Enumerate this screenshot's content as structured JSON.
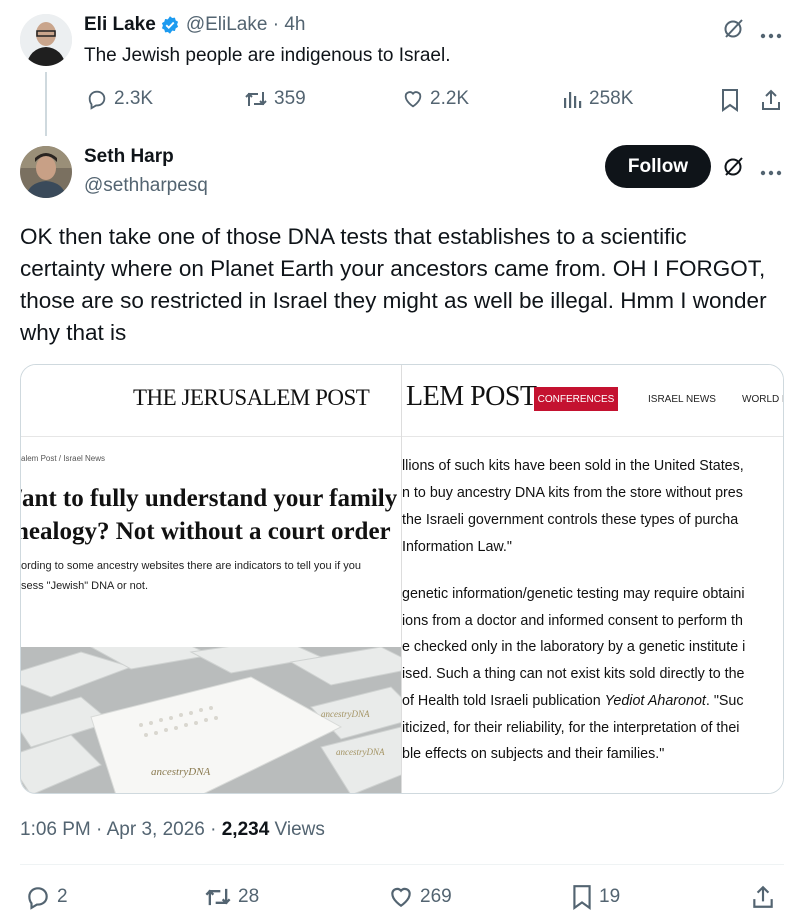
{
  "quoted_tweet": {
    "author_name": "Eli Lake",
    "handle_time": "@EliLake · 4h",
    "text": "The Jewish people are indigenous to Israel.",
    "replies": "2.3K",
    "reposts": "359",
    "likes": "2.2K",
    "views": "258K"
  },
  "main_tweet": {
    "author_name": "Seth Harp",
    "handle": "@sethharpesq",
    "follow_label": "Follow",
    "text": "OK then take one of those DNA tests that establishes to a scientific certainty where on Planet Earth your ancestors came from. OH I FORGOT, those are so restricted in Israel they might as well be illegal. Hmm I wonder why that is",
    "timestamp": "1:06 PM · Apr 3, 2026 · ",
    "view_count": "2,234",
    "views_label": " Views",
    "replies": "2",
    "reposts": "28",
    "likes": "269",
    "bookmarks": "19"
  },
  "article_left": {
    "masthead": "THE JERUSALEM POST",
    "breadcrumb": "alem Post  /  Israel News",
    "headline_1": "/ant to fully understand your family",
    "headline_2": "nealogy? Not without a court order",
    "subhead_1": "ording to some ancestry websites there are indicators to tell you if you",
    "subhead_2": "sess \"Jewish\" DNA or not.",
    "box_brand": "ancestryDNA"
  },
  "article_right": {
    "masthead": "LEM POST",
    "nav_conferences": "CONFERENCES",
    "nav_israel_news": "ISRAEL NEWS",
    "nav_world": "WORLD N",
    "para1": [
      "llions of such kits have been sold in the United States,",
      "n to buy ancestry DNA kits from the store without pres",
      " the Israeli government controls these types of purcha",
      " Information Law.\""
    ],
    "para2": [
      "genetic information/genetic testing may require obtaini",
      "ions from a doctor and informed consent to perform th",
      "e checked only in the laboratory by a genetic institute i",
      "ised. Such a thing can not exist kits sold directly to the",
      "of Health told Israeli publication ",
      "iticized, for their reliability, for the interpretation of thei",
      "ble effects on subjects and their families.\""
    ],
    "publication_italic": "Yediot Aharonot",
    "para2_line5_tail": ". \"Suc"
  },
  "colors": {
    "verified": "#1d9bf0",
    "muted": "#536471",
    "follow_bg": "#0f1419",
    "jpost_red": "#c41230"
  }
}
